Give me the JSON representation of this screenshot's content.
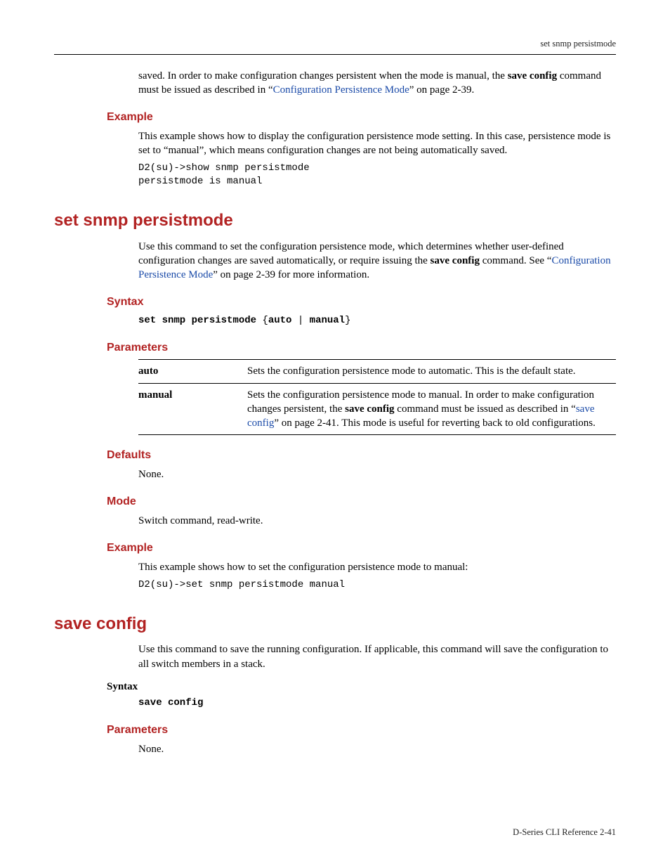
{
  "header": {
    "running_title": "set snmp persistmode"
  },
  "footer": {
    "text": "D-Series CLI Reference   2-41"
  },
  "intro": {
    "p1_pre": "saved. In order to make configuration changes persistent when the mode is manual, the ",
    "p1_bold": "save config",
    "p1_mid": " command must be issued as described in “",
    "p1_link": "Configuration Persistence Mode",
    "p1_post": "” on page 2-39."
  },
  "example1": {
    "heading": "Example",
    "para": "This example shows how to display the configuration persistence mode setting. In this case, persistence mode is set to “manual”, which means configuration changes are not being automatically saved.",
    "code": "D2(su)->show snmp persistmode\npersistmode is manual"
  },
  "cmd1": {
    "title": "set snmp persistmode",
    "desc_pre": "Use this command to set the configuration persistence mode, which determines whether user-defined configuration changes are saved automatically, or require issuing the ",
    "desc_bold": "save config",
    "desc_mid": " command. See “",
    "desc_link": "Configuration Persistence Mode",
    "desc_post": "” on page 2-39 for more information.",
    "syntax_heading": "Syntax",
    "syntax_cmd": "set snmp persistmode",
    "syntax_brace_open": " {",
    "syntax_opt1": "auto",
    "syntax_pipe": " | ",
    "syntax_opt2": "manual",
    "syntax_brace_close": "}",
    "parameters_heading": "Parameters",
    "params": [
      {
        "name": "auto",
        "desc": "Sets the configuration persistence mode to automatic. This is the default state."
      },
      {
        "name": "manual",
        "desc_pre": "Sets the configuration persistence mode to manual. In order to make configuration changes persistent, the ",
        "desc_bold": "save config",
        "desc_mid": " command must be issued as described in “",
        "desc_link": "save config",
        "desc_post": "” on page 2-41. This mode is useful for reverting back to old configurations."
      }
    ],
    "defaults_heading": "Defaults",
    "defaults_text": "None.",
    "mode_heading": "Mode",
    "mode_text": "Switch command, read-write.",
    "example_heading": "Example",
    "example_para": "This example shows how to set the configuration persistence mode to manual:",
    "example_code": "D2(su)->set snmp persistmode manual"
  },
  "cmd2": {
    "title": "save config",
    "desc": "Use this command to save the running configuration. If applicable, this command will save the configuration to all switch members in a stack.",
    "syntax_heading": "Syntax",
    "syntax_cmd": "save config",
    "parameters_heading": "Parameters",
    "parameters_text": "None."
  }
}
